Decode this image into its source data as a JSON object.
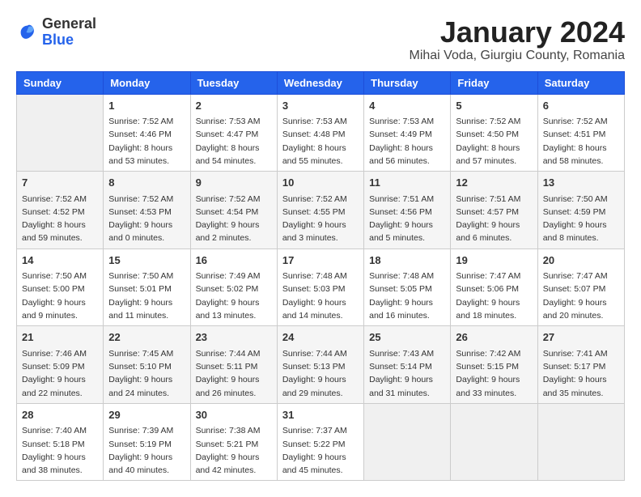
{
  "header": {
    "logo": {
      "line1": "General",
      "line2": "Blue"
    },
    "title": "January 2024",
    "subtitle": "Mihai Voda, Giurgiu County, Romania"
  },
  "weekdays": [
    "Sunday",
    "Monday",
    "Tuesday",
    "Wednesday",
    "Thursday",
    "Friday",
    "Saturday"
  ],
  "weeks": [
    [
      {
        "day": "",
        "sunrise": "",
        "sunset": "",
        "daylight": ""
      },
      {
        "day": "1",
        "sunrise": "Sunrise: 7:52 AM",
        "sunset": "Sunset: 4:46 PM",
        "daylight": "Daylight: 8 hours and 53 minutes."
      },
      {
        "day": "2",
        "sunrise": "Sunrise: 7:53 AM",
        "sunset": "Sunset: 4:47 PM",
        "daylight": "Daylight: 8 hours and 54 minutes."
      },
      {
        "day": "3",
        "sunrise": "Sunrise: 7:53 AM",
        "sunset": "Sunset: 4:48 PM",
        "daylight": "Daylight: 8 hours and 55 minutes."
      },
      {
        "day": "4",
        "sunrise": "Sunrise: 7:53 AM",
        "sunset": "Sunset: 4:49 PM",
        "daylight": "Daylight: 8 hours and 56 minutes."
      },
      {
        "day": "5",
        "sunrise": "Sunrise: 7:52 AM",
        "sunset": "Sunset: 4:50 PM",
        "daylight": "Daylight: 8 hours and 57 minutes."
      },
      {
        "day": "6",
        "sunrise": "Sunrise: 7:52 AM",
        "sunset": "Sunset: 4:51 PM",
        "daylight": "Daylight: 8 hours and 58 minutes."
      }
    ],
    [
      {
        "day": "7",
        "sunrise": "Sunrise: 7:52 AM",
        "sunset": "Sunset: 4:52 PM",
        "daylight": "Daylight: 8 hours and 59 minutes."
      },
      {
        "day": "8",
        "sunrise": "Sunrise: 7:52 AM",
        "sunset": "Sunset: 4:53 PM",
        "daylight": "Daylight: 9 hours and 0 minutes."
      },
      {
        "day": "9",
        "sunrise": "Sunrise: 7:52 AM",
        "sunset": "Sunset: 4:54 PM",
        "daylight": "Daylight: 9 hours and 2 minutes."
      },
      {
        "day": "10",
        "sunrise": "Sunrise: 7:52 AM",
        "sunset": "Sunset: 4:55 PM",
        "daylight": "Daylight: 9 hours and 3 minutes."
      },
      {
        "day": "11",
        "sunrise": "Sunrise: 7:51 AM",
        "sunset": "Sunset: 4:56 PM",
        "daylight": "Daylight: 9 hours and 5 minutes."
      },
      {
        "day": "12",
        "sunrise": "Sunrise: 7:51 AM",
        "sunset": "Sunset: 4:57 PM",
        "daylight": "Daylight: 9 hours and 6 minutes."
      },
      {
        "day": "13",
        "sunrise": "Sunrise: 7:50 AM",
        "sunset": "Sunset: 4:59 PM",
        "daylight": "Daylight: 9 hours and 8 minutes."
      }
    ],
    [
      {
        "day": "14",
        "sunrise": "Sunrise: 7:50 AM",
        "sunset": "Sunset: 5:00 PM",
        "daylight": "Daylight: 9 hours and 9 minutes."
      },
      {
        "day": "15",
        "sunrise": "Sunrise: 7:50 AM",
        "sunset": "Sunset: 5:01 PM",
        "daylight": "Daylight: 9 hours and 11 minutes."
      },
      {
        "day": "16",
        "sunrise": "Sunrise: 7:49 AM",
        "sunset": "Sunset: 5:02 PM",
        "daylight": "Daylight: 9 hours and 13 minutes."
      },
      {
        "day": "17",
        "sunrise": "Sunrise: 7:48 AM",
        "sunset": "Sunset: 5:03 PM",
        "daylight": "Daylight: 9 hours and 14 minutes."
      },
      {
        "day": "18",
        "sunrise": "Sunrise: 7:48 AM",
        "sunset": "Sunset: 5:05 PM",
        "daylight": "Daylight: 9 hours and 16 minutes."
      },
      {
        "day": "19",
        "sunrise": "Sunrise: 7:47 AM",
        "sunset": "Sunset: 5:06 PM",
        "daylight": "Daylight: 9 hours and 18 minutes."
      },
      {
        "day": "20",
        "sunrise": "Sunrise: 7:47 AM",
        "sunset": "Sunset: 5:07 PM",
        "daylight": "Daylight: 9 hours and 20 minutes."
      }
    ],
    [
      {
        "day": "21",
        "sunrise": "Sunrise: 7:46 AM",
        "sunset": "Sunset: 5:09 PM",
        "daylight": "Daylight: 9 hours and 22 minutes."
      },
      {
        "day": "22",
        "sunrise": "Sunrise: 7:45 AM",
        "sunset": "Sunset: 5:10 PM",
        "daylight": "Daylight: 9 hours and 24 minutes."
      },
      {
        "day": "23",
        "sunrise": "Sunrise: 7:44 AM",
        "sunset": "Sunset: 5:11 PM",
        "daylight": "Daylight: 9 hours and 26 minutes."
      },
      {
        "day": "24",
        "sunrise": "Sunrise: 7:44 AM",
        "sunset": "Sunset: 5:13 PM",
        "daylight": "Daylight: 9 hours and 29 minutes."
      },
      {
        "day": "25",
        "sunrise": "Sunrise: 7:43 AM",
        "sunset": "Sunset: 5:14 PM",
        "daylight": "Daylight: 9 hours and 31 minutes."
      },
      {
        "day": "26",
        "sunrise": "Sunrise: 7:42 AM",
        "sunset": "Sunset: 5:15 PM",
        "daylight": "Daylight: 9 hours and 33 minutes."
      },
      {
        "day": "27",
        "sunrise": "Sunrise: 7:41 AM",
        "sunset": "Sunset: 5:17 PM",
        "daylight": "Daylight: 9 hours and 35 minutes."
      }
    ],
    [
      {
        "day": "28",
        "sunrise": "Sunrise: 7:40 AM",
        "sunset": "Sunset: 5:18 PM",
        "daylight": "Daylight: 9 hours and 38 minutes."
      },
      {
        "day": "29",
        "sunrise": "Sunrise: 7:39 AM",
        "sunset": "Sunset: 5:19 PM",
        "daylight": "Daylight: 9 hours and 40 minutes."
      },
      {
        "day": "30",
        "sunrise": "Sunrise: 7:38 AM",
        "sunset": "Sunset: 5:21 PM",
        "daylight": "Daylight: 9 hours and 42 minutes."
      },
      {
        "day": "31",
        "sunrise": "Sunrise: 7:37 AM",
        "sunset": "Sunset: 5:22 PM",
        "daylight": "Daylight: 9 hours and 45 minutes."
      },
      {
        "day": "",
        "sunrise": "",
        "sunset": "",
        "daylight": ""
      },
      {
        "day": "",
        "sunrise": "",
        "sunset": "",
        "daylight": ""
      },
      {
        "day": "",
        "sunrise": "",
        "sunset": "",
        "daylight": ""
      }
    ]
  ]
}
